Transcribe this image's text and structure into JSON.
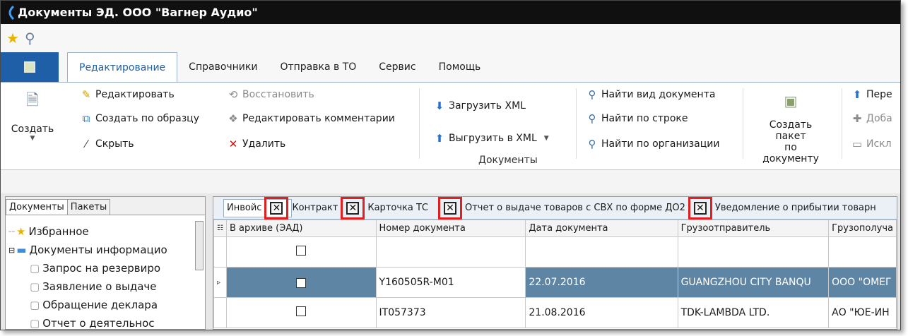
{
  "window": {
    "title": "Документы ЭД. ООО \"Вагнер Аудио\""
  },
  "ribbon_tabs": [
    "Редактирование",
    "Справочники",
    "Отправка в ТО",
    "Сервис",
    "Помощь"
  ],
  "ribbon": {
    "create_label": "Создать",
    "edit": "Редактировать",
    "create_from_template": "Создать по образцу",
    "hide": "Скрыть",
    "restore": "Восстановить",
    "edit_comments": "Редактировать комментарии",
    "delete": "Удалить",
    "load_xml": "Загрузить XML",
    "export_xml": "Выгрузить в XML",
    "find_doc_type": "Найти вид документа",
    "find_by_row": "Найти по строке",
    "find_by_org": "Найти по организации",
    "group_documents": "Документы",
    "create_package_line1": "Создать пакет",
    "create_package_line2": "по документу",
    "trunc_1": "Пере",
    "trunc_2": "Доба",
    "trunc_3": "Искл"
  },
  "left_pane": {
    "tabs": [
      "Документы",
      "Пакеты"
    ],
    "tree": [
      "Избранное",
      "Документы информацио",
      "Запрос на резервиро",
      "Заявление о выдаче",
      "Обращение деклара",
      "Отчет о деятельнос"
    ]
  },
  "doc_tabs": [
    "Инвойс",
    "Контракт",
    "Карточка ТС",
    "Отчет о выдаче товаров с СВХ по форме ДО2",
    "Уведомление о прибытии товарн"
  ],
  "grid": {
    "columns": [
      "В архиве (ЭАД)",
      "Номер документа",
      "Дата документа",
      "Грузоотправитель",
      "Грузополуча"
    ],
    "rows": [
      {
        "archived": false,
        "number": "",
        "date": "",
        "shipper": "",
        "consignee": ""
      },
      {
        "archived": true,
        "number": "Y160505R-M01",
        "date": "22.07.2016",
        "shipper": "GUANGZHOU CITY BANQU",
        "consignee": "ООО \"ОМЕГ"
      },
      {
        "archived": false,
        "number": "IT057373",
        "date": "21.08.2016",
        "shipper": "TDK-LAMBDA LTD.",
        "consignee": "АО \"ЮЕ-ИН"
      }
    ]
  }
}
